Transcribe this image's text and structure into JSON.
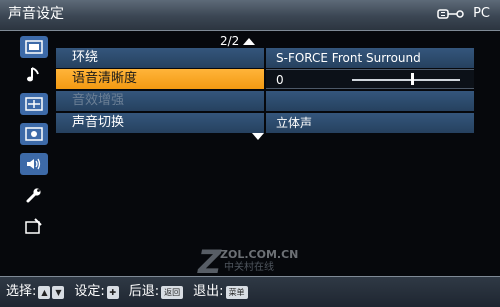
{
  "window": {
    "title": "声音设定",
    "input_source": "PC"
  },
  "sidebar": {
    "items": [
      {
        "icon": "picture-icon",
        "active": false
      },
      {
        "icon": "music-note-icon",
        "active": true
      },
      {
        "icon": "screen-adjust-icon",
        "active": false
      },
      {
        "icon": "features-icon",
        "active": false
      },
      {
        "icon": "speaker-icon",
        "active": false
      },
      {
        "icon": "wrench-icon",
        "active": false
      },
      {
        "icon": "setup-icon",
        "active": false
      }
    ]
  },
  "menu": {
    "page_indicator": "2/2",
    "rows": [
      {
        "label": "环绕",
        "value": "S-FORCE Front Surround",
        "state": "normal"
      },
      {
        "label": "语音清晰度",
        "value": "0",
        "state": "selected",
        "slider_fraction": 0.55
      },
      {
        "label": "音效增强",
        "value": "",
        "state": "disabled"
      },
      {
        "label": "声音切换",
        "value": "立体声",
        "state": "normal"
      }
    ]
  },
  "watermark": {
    "url": "ZOL.COM.CN",
    "cn": "中关村在线"
  },
  "help_bar": {
    "select_label": "选择:",
    "set_label": "设定:",
    "back_label": "后退:",
    "back_key": "返回",
    "exit_label": "退出:",
    "exit_key": "菜单"
  }
}
